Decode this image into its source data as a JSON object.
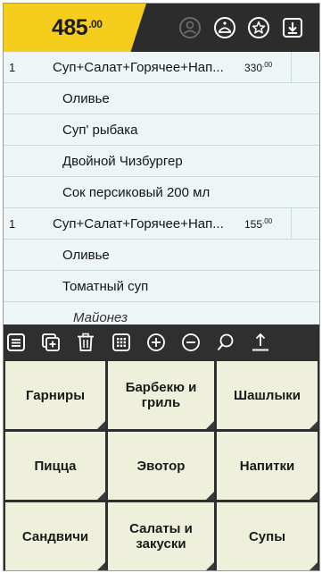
{
  "header": {
    "total_main": "485",
    "total_cents": ".00",
    "icons": [
      "user-icon",
      "waiter-icon",
      "star-icon",
      "download-icon"
    ]
  },
  "order": {
    "rows": [
      {
        "type": "item",
        "qty": "1",
        "name": "Суп+Салат+Горячее+Нап...",
        "price": "330",
        "cents": ".00"
      },
      {
        "type": "mod",
        "name": "Оливье"
      },
      {
        "type": "mod",
        "name": "Суп' рыбака"
      },
      {
        "type": "mod",
        "name": "Двойной Чизбургер"
      },
      {
        "type": "mod",
        "name": "Сок персиковый 200 мл"
      },
      {
        "type": "item",
        "qty": "1",
        "name": "Суп+Салат+Горячее+Нап...",
        "price": "155",
        "cents": ".00"
      },
      {
        "type": "mod",
        "name": "Оливье"
      },
      {
        "type": "mod",
        "name": "Томатный суп"
      },
      {
        "type": "modifier",
        "name": "Майонез"
      }
    ]
  },
  "toolbar": {
    "icons": [
      "list-icon",
      "add-copy-icon",
      "trash-icon",
      "keypad-icon",
      "plus-icon",
      "minus-icon",
      "search-icon",
      "upload-icon"
    ]
  },
  "categories": [
    {
      "label": "Гарниры"
    },
    {
      "label": "Барбекю и гриль"
    },
    {
      "label": "Шашлыки"
    },
    {
      "label": "Пицца"
    },
    {
      "label": "Эвотор"
    },
    {
      "label": "Напитки"
    },
    {
      "label": "Сандвичи"
    },
    {
      "label": "Салаты и закуски"
    },
    {
      "label": "Супы"
    }
  ]
}
